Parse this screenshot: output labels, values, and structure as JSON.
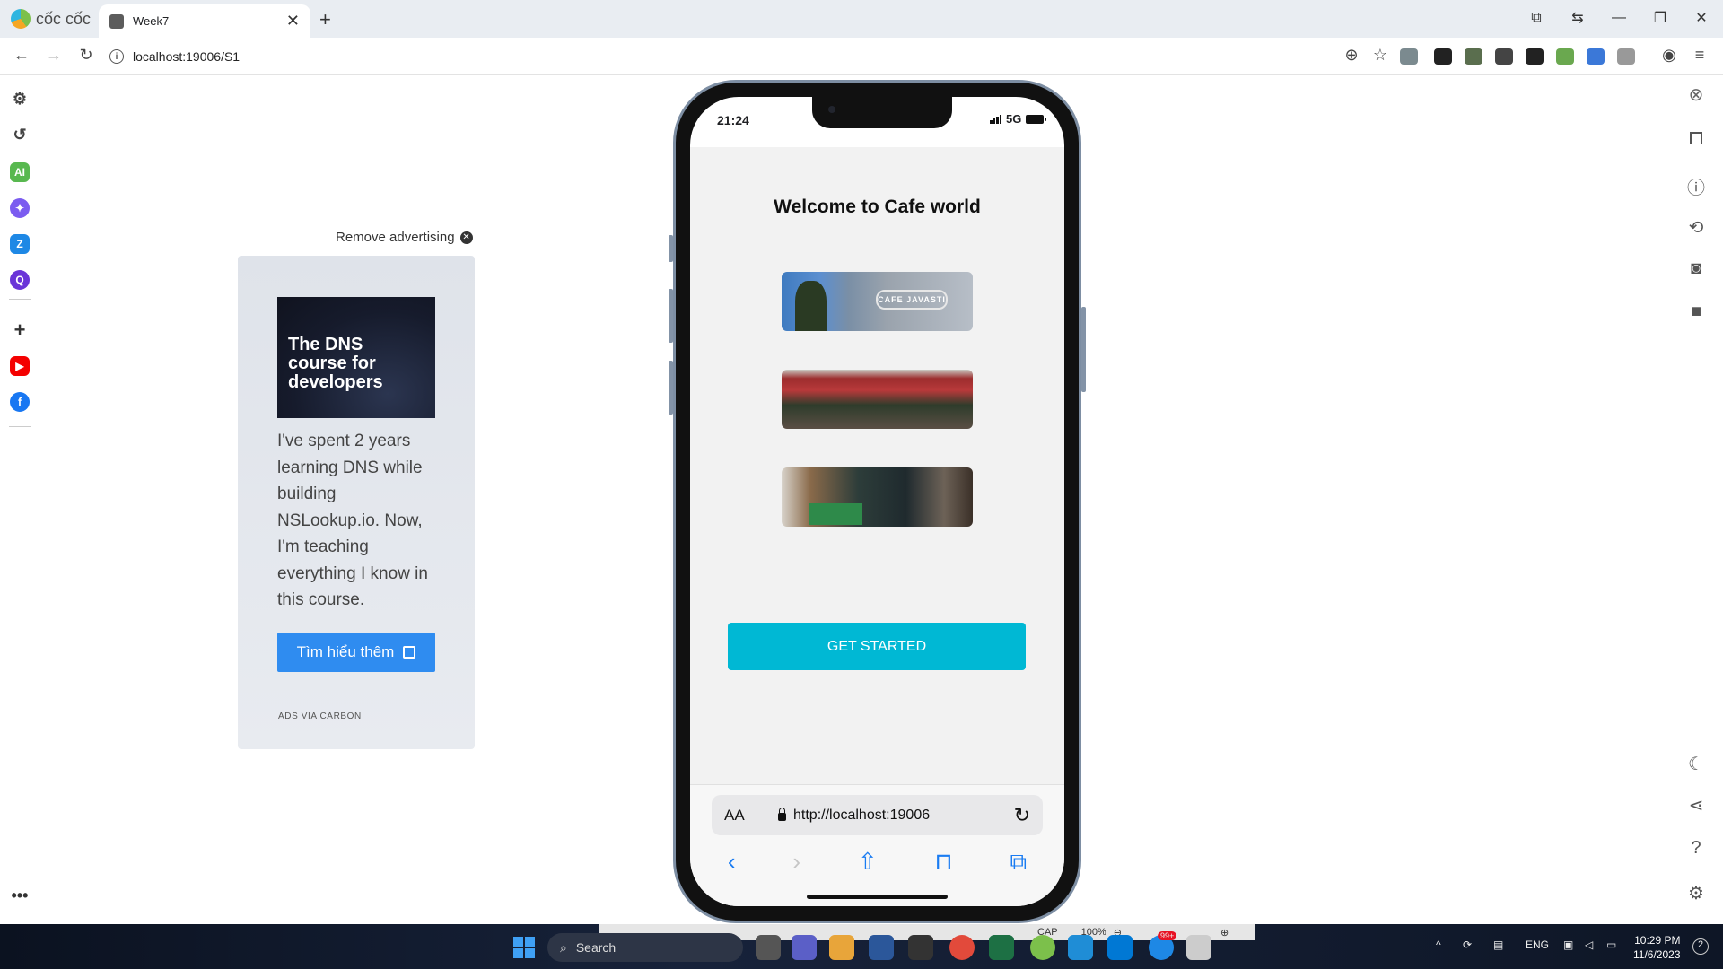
{
  "browser": {
    "brand": "cốc cốc",
    "tab_title": "Week7",
    "url": "localhost:19006/S1"
  },
  "ad": {
    "remove_label": "Remove advertising",
    "image_headline": "The DNS course for developers",
    "body": "I've spent 2 years learning DNS while building NSLookup.io. Now, I'm teaching everything I know in this course.",
    "button_label": "Tìm hiểu thêm",
    "footer": "ADS VIA CARBON"
  },
  "phone": {
    "time": "21:24",
    "network": "5G",
    "app_title": "Welcome to Cafe world",
    "photo1_sign": "CAFE JAVASTI",
    "cta_label": "GET STARTED",
    "safari": {
      "aa_label": "AA",
      "url": "http://localhost:19006"
    }
  },
  "status": {
    "caps": "CAP",
    "zoom": "100%"
  },
  "taskbar": {
    "search_placeholder": "Search",
    "lang": "ENG",
    "time": "10:29 PM",
    "date": "11/6/2023",
    "notification_count": "2",
    "badge": "99+"
  },
  "colors": {
    "accent_cta": "#00b8d4",
    "ad_button": "#2f8cf0",
    "safari_blue": "#1a7cf2"
  }
}
